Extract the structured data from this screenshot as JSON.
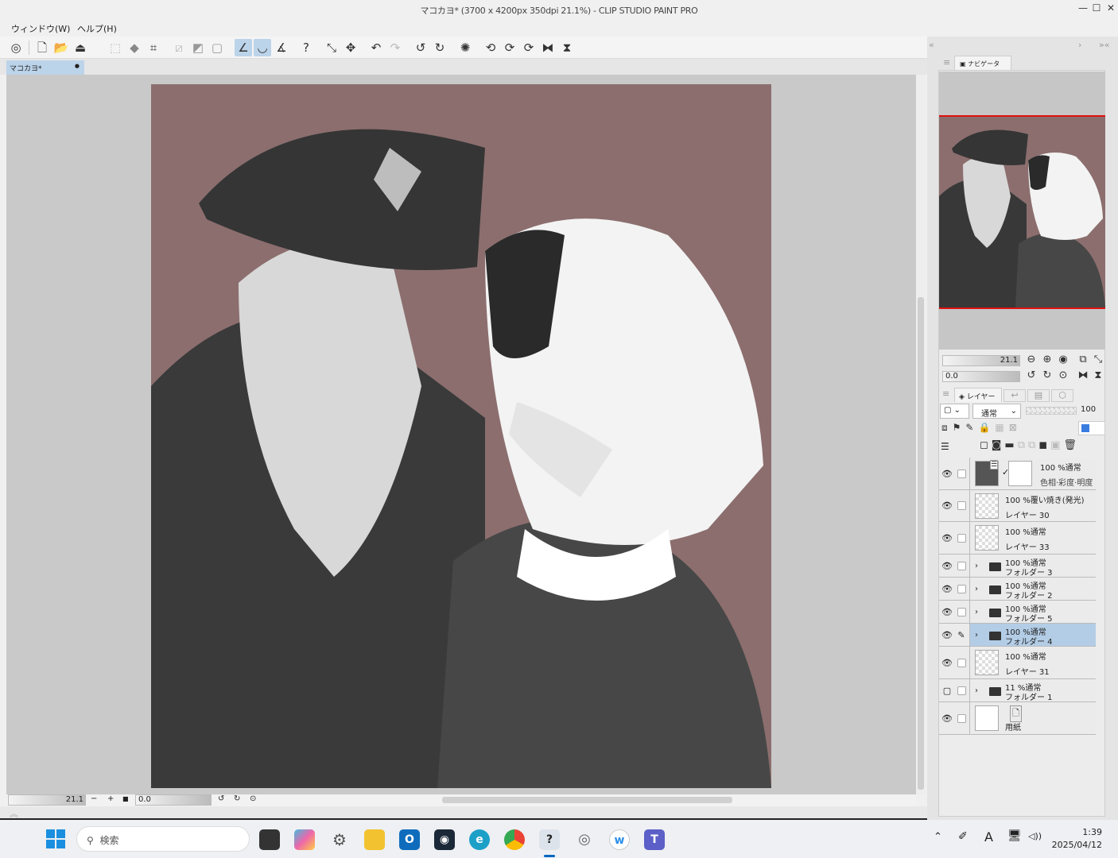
{
  "window": {
    "title": "マコカヨ* (3700 x 4200px 350dpi 21.1%)  - CLIP STUDIO PAINT PRO",
    "minimize": "—",
    "maximize": "☐",
    "close": "✕"
  },
  "menu": [
    {
      "label": "ウィンドウ(W)"
    },
    {
      "label": "ヘルプ(H)"
    }
  ],
  "document_tab": {
    "label": "マコカヨ*",
    "modified_dot": "●"
  },
  "status": {
    "zoom": "21.1",
    "rotation": "0.0",
    "minus": "−",
    "plus": "+"
  },
  "navigator": {
    "tab_label": "ナビゲーター",
    "zoom": "21.1",
    "rotation": "0.0"
  },
  "layer_panel": {
    "tab_label": "レイヤー",
    "blend_mode": "通常",
    "opacity": "100",
    "layers": [
      {
        "opacity_mode": "100 %通常",
        "name": "色相·彩度·明度",
        "type": "adjustment",
        "visible": true
      },
      {
        "opacity_mode": "100 %覆い焼き(発光)",
        "name": "レイヤー 30",
        "type": "raster",
        "visible": true
      },
      {
        "opacity_mode": "100 %通常",
        "name": "レイヤー 33",
        "type": "raster",
        "visible": true
      },
      {
        "opacity_mode": "100 %通常",
        "name": "フォルダー 3",
        "type": "folder",
        "visible": true
      },
      {
        "opacity_mode": "100 %通常",
        "name": "フォルダー 2",
        "type": "folder",
        "visible": true
      },
      {
        "opacity_mode": "100 %通常",
        "name": "フォルダー 5",
        "type": "folder",
        "visible": true
      },
      {
        "opacity_mode": "100 %通常",
        "name": "フォルダー 4",
        "type": "folder",
        "visible": true,
        "selected": true
      },
      {
        "opacity_mode": "100 %通常",
        "name": "レイヤー 31",
        "type": "raster",
        "visible": true
      },
      {
        "opacity_mode": "11 %通常",
        "name": "フォルダー 1",
        "type": "folder",
        "visible": false
      },
      {
        "opacity_mode": "",
        "name": "用紙",
        "type": "paper",
        "visible": true
      }
    ]
  },
  "taskbar": {
    "search_placeholder": "検索",
    "time": "1:39",
    "date": "2025/04/12"
  },
  "colors": {
    "canvas_bg": "#8c6e6e",
    "selection": "#b3cde6",
    "accent_red": "#e01010"
  }
}
